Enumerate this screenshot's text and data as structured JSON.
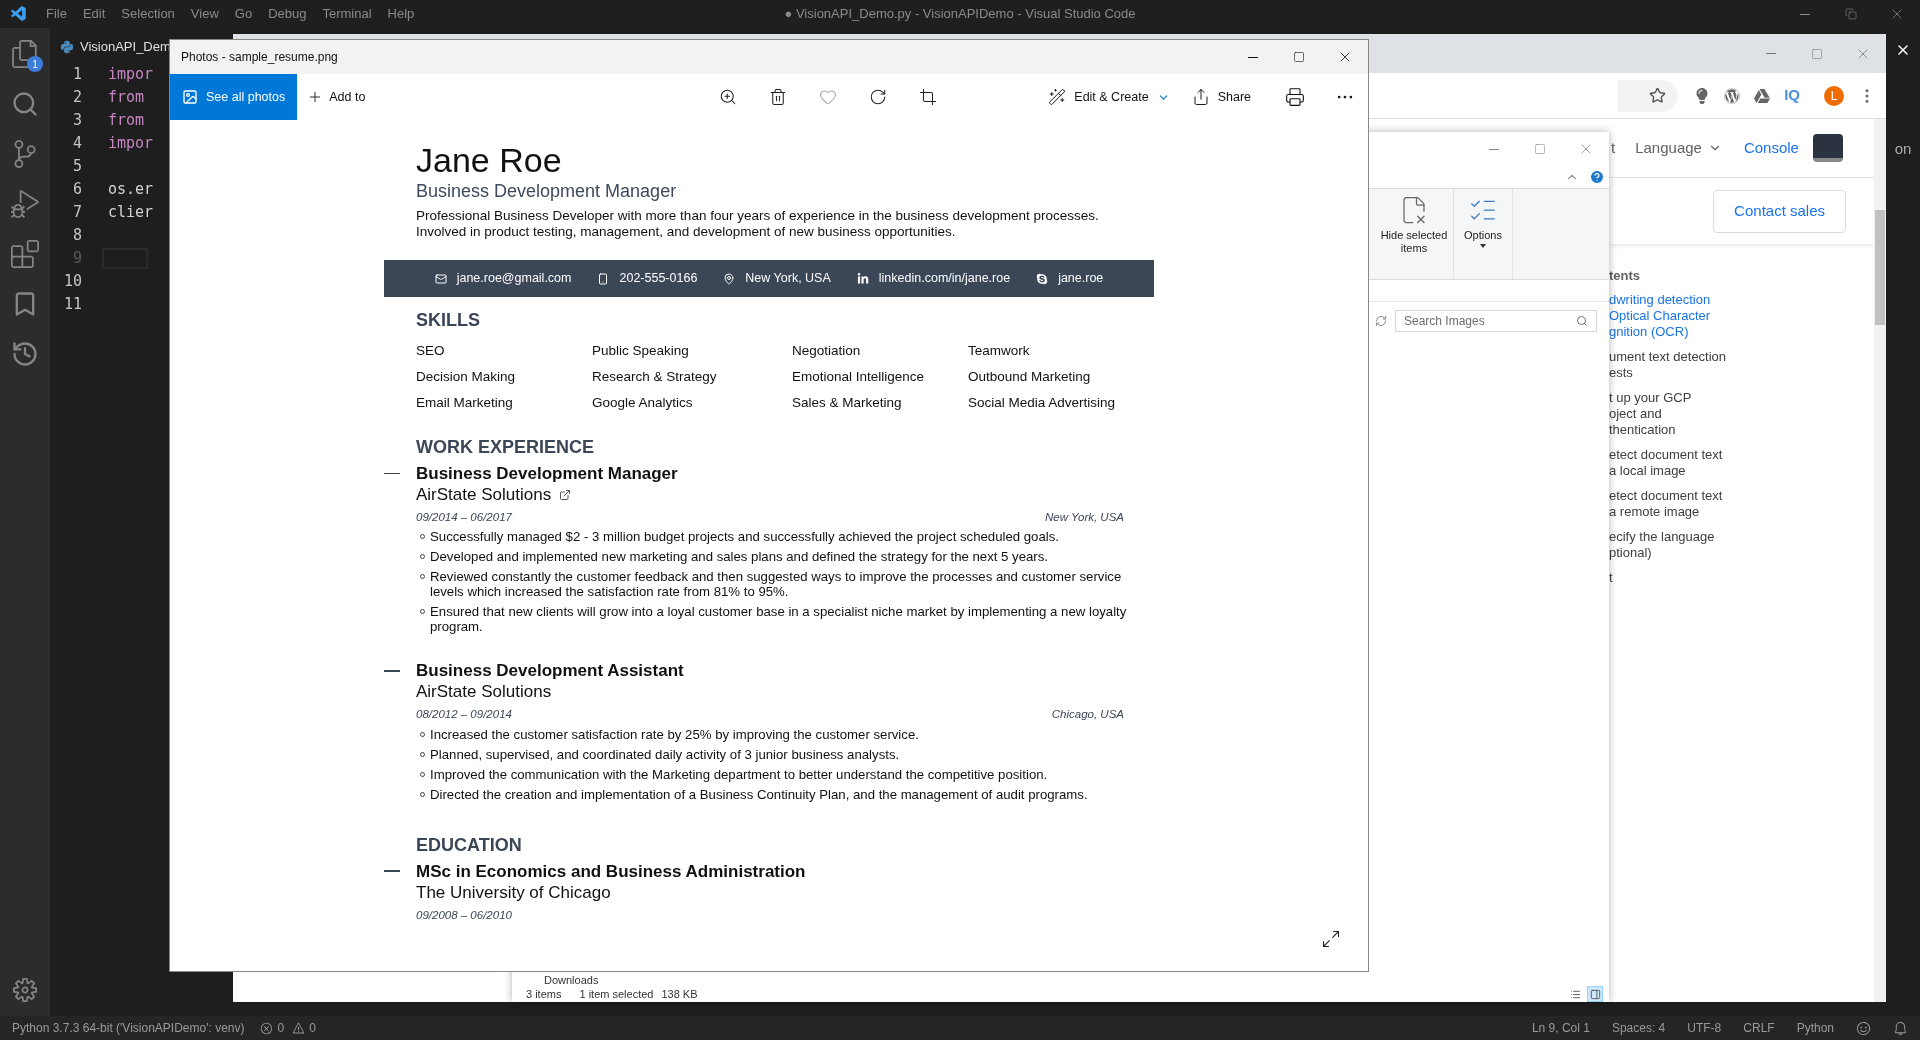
{
  "vscode": {
    "title": "● VisionAPI_Demo.py - VisionAPIDemo - Visual Studio Code",
    "menu": [
      "File",
      "Edit",
      "Selection",
      "View",
      "Go",
      "Debug",
      "Terminal",
      "Help"
    ],
    "activity_badge": "1",
    "tab": "VisionAPI_Dem",
    "lines": [
      {
        "number": "1",
        "code": "impor",
        "kind": "keyword",
        "current": false
      },
      {
        "number": "2",
        "code": "from",
        "kind": "keyword",
        "current": false
      },
      {
        "number": "3",
        "code": "from",
        "kind": "keyword",
        "current": false
      },
      {
        "number": "4",
        "code": "impor",
        "kind": "keyword",
        "current": false
      },
      {
        "number": "5",
        "kind": "blank",
        "current": false
      },
      {
        "number": "6",
        "code": "os.er",
        "kind": "plain",
        "current": false
      },
      {
        "number": "7",
        "code": "clier",
        "kind": "plain",
        "current": false
      },
      {
        "number": "8",
        "kind": "blank",
        "current": false
      },
      {
        "number": "9",
        "kind": "blank",
        "current": true
      },
      {
        "number": "10",
        "kind": "blank",
        "current": false
      },
      {
        "number": "11",
        "kind": "blank",
        "current": false
      }
    ],
    "status_bar": {
      "interpreter": "Python 3.7.3 64-bit ('VisionAPIDemo': venv)",
      "errors": "0",
      "warnings": "0",
      "items": [
        "Ln 9, Col 1",
        "Spaces: 4",
        "UTF-8",
        "CRLF",
        "Python"
      ]
    }
  },
  "browser": {
    "extension_label": "IQ",
    "avatar_letter": "L",
    "header": {
      "cut_link": "t",
      "language": "Language",
      "console": "Console"
    },
    "contact_button": "Contact sales",
    "contents_heading": "tents",
    "contents": [
      {
        "kind": "link",
        "lines": [
          "dwriting detection",
          "Optical Character",
          "gnition (OCR)"
        ]
      },
      {
        "kind": "text",
        "lines": [
          "ument text detection",
          "ests"
        ]
      },
      {
        "kind": "text",
        "lines": [
          "t up your GCP",
          "oject and",
          "thentication"
        ]
      },
      {
        "kind": "text",
        "lines": [
          "etect document text",
          "a local image"
        ]
      },
      {
        "kind": "text",
        "lines": [
          "etect document text",
          "a remote image"
        ]
      },
      {
        "kind": "text",
        "lines": [
          "ecify the language",
          "ptional)"
        ]
      },
      {
        "kind": "text",
        "lines": [
          "t"
        ]
      }
    ],
    "edge_text": "on"
  },
  "explorer": {
    "ribbon_buttons": [
      {
        "kind": "hide",
        "label": "Hide selected items",
        "dropdown": false
      },
      {
        "kind": "options",
        "label": "Options",
        "dropdown": true
      }
    ],
    "search_placeholder": "Search Images",
    "nav_item": "Downloads",
    "status": [
      "3 items",
      "1 item selected",
      "138 KB"
    ],
    "views": [
      {
        "kind": "details",
        "selected": false
      },
      {
        "kind": "preview",
        "selected": true
      }
    ]
  },
  "photos": {
    "title": "Photos - sample_resume.png",
    "see_all": {
      "label": "See all photos",
      "selected": true
    },
    "add_to": "Add to",
    "tools": [
      {
        "kind": "zoom"
      },
      {
        "kind": "delete"
      },
      {
        "kind": "favorite"
      },
      {
        "kind": "rotate"
      },
      {
        "kind": "crop"
      }
    ],
    "edit_create": "Edit & Create",
    "share": "Share"
  },
  "resume": {
    "name": "Jane Roe",
    "title": "Business Development Manager",
    "summary": "Professional Business Developer with more than four years of experience in the business development processes. Involved in product testing, management, and development of new business opportunities.",
    "contacts": [
      {
        "kind": "email",
        "text": "jane.roe@gmail.com"
      },
      {
        "kind": "phone",
        "text": "202-555-0166"
      },
      {
        "kind": "location",
        "text": "New York, USA"
      },
      {
        "kind": "linkedin",
        "text": "linkedin.com/in/jane.roe"
      },
      {
        "kind": "skype",
        "text": "jane.roe"
      }
    ],
    "sections": [
      {
        "kind": "skills",
        "heading": "SKILLS",
        "skills": [
          "SEO",
          "Public Speaking",
          "Negotiation",
          "Teamwork",
          "Decision Making",
          "Research & Strategy",
          "Emotional Intelligence",
          "Outbound Marketing",
          "Email Marketing",
          "Google Analytics",
          "Sales & Marketing",
          "Social Media Advertising"
        ]
      },
      {
        "kind": "entries",
        "heading": "WORK EXPERIENCE",
        "entries": [
          {
            "title": "Business Development Manager",
            "organization": "AirState Solutions",
            "link": true,
            "dates": "09/2014 – 06/2017",
            "location": "New York, USA",
            "bullets": [
              "Successfully managed $2 - 3 million budget projects and successfully achieved the project scheduled goals.",
              "Developed and implemented new marketing and sales plans and defined the strategy for the next 5 years.",
              "Reviewed constantly the customer feedback and then suggested ways to improve the processes and customer service levels which increased the satisfaction rate from 81% to 95%.",
              "Ensured that new clients will grow into a loyal customer base in a specialist niche market by implementing a new loyalty program."
            ]
          },
          {
            "title": "Business Development Assistant",
            "organization": "AirState Solutions",
            "link": false,
            "dates": "08/2012 – 09/2014",
            "location": "Chicago, USA",
            "bullets": [
              "Increased the customer satisfaction rate by 25% by improving the customer service.",
              "Planned, supervised, and coordinated daily activity of 3 junior business analysts.",
              "Improved the communication with the Marketing department to better understand the competitive position.",
              "Directed the creation and implementation of a Business Continuity Plan, and the management of audit programs."
            ]
          }
        ]
      },
      {
        "kind": "entries",
        "heading": "EDUCATION",
        "entries": [
          {
            "title": "MSc in Economics and Business Administration",
            "organization": "The University of Chicago",
            "link": false,
            "dates": "09/2008 – 06/2010"
          }
        ]
      }
    ]
  }
}
